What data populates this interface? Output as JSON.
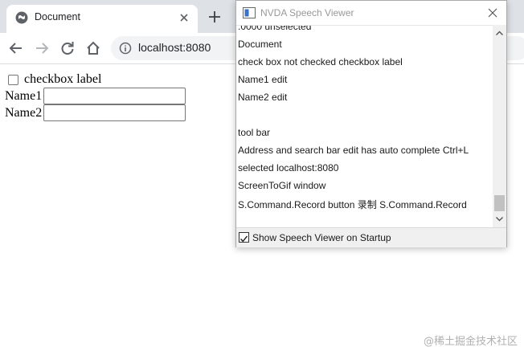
{
  "browser": {
    "tab_title": "Document",
    "address": "localhost:8080"
  },
  "page": {
    "checkbox_label": "checkbox label",
    "name1_label": "Name1",
    "name1_value": "",
    "name2_label": "Name2",
    "name2_value": ""
  },
  "nvda": {
    "title": "NVDA Speech Viewer",
    "lines": [
      ".0000 unselected",
      "Document",
      "check box  not checked    checkbox label",
      "Name1  edit",
      "Name2  edit",
      "",
      "tool bar",
      "Address and search bar  edit  has auto complete  Ctrl+L",
      "selected localhost:8080",
      "ScreenToGif  window",
      "S.Command.Record  button  录制  S.Command.Record"
    ],
    "startup_checkbox_label": "Show Speech Viewer on Startup",
    "startup_checked": true
  },
  "watermark": "@稀土掘金技术社区",
  "colors": {
    "tabstrip": "#dee1e6",
    "omnibox": "#f1f3f4",
    "scroll_thumb": "#c1c1c1"
  }
}
